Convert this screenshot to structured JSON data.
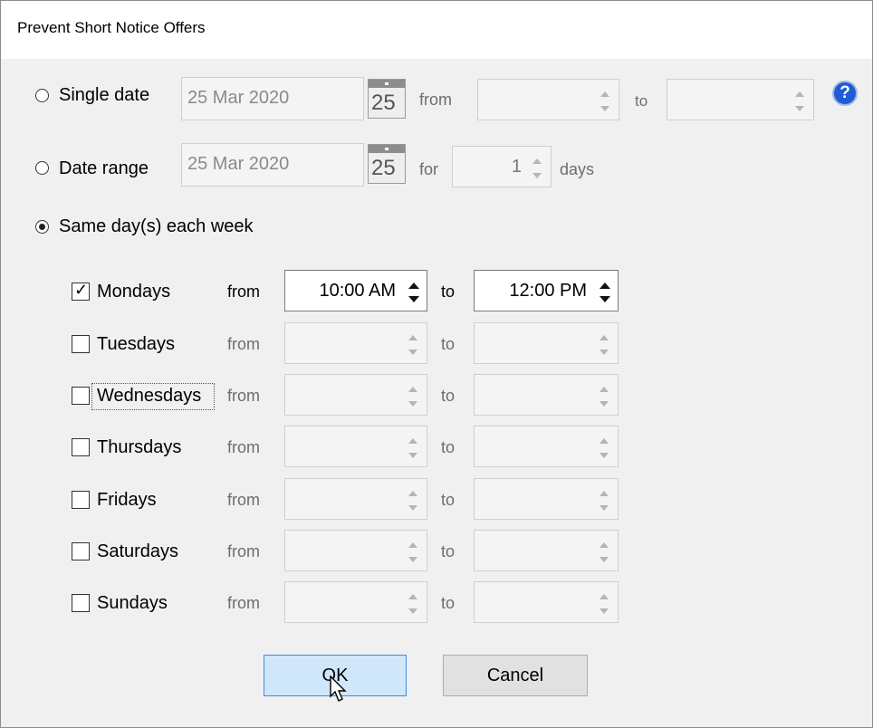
{
  "dialog": {
    "title": "Prevent Short Notice Offers"
  },
  "options": {
    "single_date": {
      "label": "Single date",
      "date": "25 Mar 2020",
      "calendar_day": "25",
      "from_label": "from",
      "to_label": "to",
      "selected": false
    },
    "date_range": {
      "label": "Date range",
      "date": "25 Mar 2020",
      "calendar_day": "25",
      "for_label": "for",
      "days_value": "1",
      "days_label": "days",
      "selected": false
    },
    "same_days": {
      "label": "Same day(s) each week",
      "selected": true
    }
  },
  "days": [
    {
      "label": "Mondays",
      "checked": true,
      "from_label": "from",
      "from_value": "10:00 AM",
      "to_label": "to",
      "to_value": "12:00 PM"
    },
    {
      "label": "Tuesdays",
      "checked": false,
      "from_label": "from",
      "from_value": "",
      "to_label": "to",
      "to_value": ""
    },
    {
      "label": "Wednesdays",
      "checked": false,
      "from_label": "from",
      "from_value": "",
      "to_label": "to",
      "to_value": ""
    },
    {
      "label": "Thursdays",
      "checked": false,
      "from_label": "from",
      "from_value": "",
      "to_label": "to",
      "to_value": ""
    },
    {
      "label": "Fridays",
      "checked": false,
      "from_label": "from",
      "from_value": "",
      "to_label": "to",
      "to_value": ""
    },
    {
      "label": "Saturdays",
      "checked": false,
      "from_label": "from",
      "from_value": "",
      "to_label": "to",
      "to_value": ""
    },
    {
      "label": "Sundays",
      "checked": false,
      "from_label": "from",
      "from_value": "",
      "to_label": "to",
      "to_value": ""
    }
  ],
  "help": {
    "icon": "question-help-icon",
    "glyph": "?"
  },
  "buttons": {
    "ok": "OK",
    "cancel": "Cancel"
  },
  "colors": {
    "ok_bg": "#cfe6fb",
    "ok_border": "#3f8ce0",
    "help_blue": "#1e5bd6"
  }
}
